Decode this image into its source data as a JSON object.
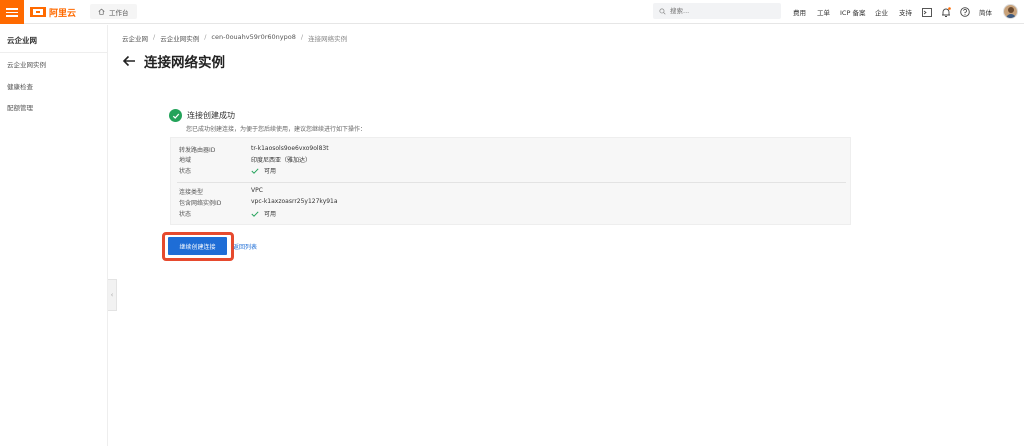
{
  "topbar": {
    "logo_text": "阿里云",
    "workbench_label": "工作台",
    "search_placeholder": "搜索...",
    "nav": [
      "费用",
      "工单",
      "ICP 备案",
      "企业",
      "支持"
    ],
    "lang_label": "简体",
    "icons": [
      "menu-icon",
      "home-icon",
      "search-icon",
      "terminal-icon",
      "bell-icon",
      "help-icon"
    ]
  },
  "sidebar": {
    "title": "云企业网",
    "items": [
      "云企业网实例",
      "健康检查",
      "配额管理"
    ]
  },
  "breadcrumb": [
    "云企业网",
    "云企业网实例",
    "cen-0ouahv59r0r60nypo8",
    "连接网络实例"
  ],
  "page": {
    "title": "连接网络实例"
  },
  "result": {
    "title": "连接创建成功",
    "description": "您已成功创建连接，为便于您后续使用，建议您继续进行如下操作："
  },
  "router_info": {
    "router_id_label": "转发路由器ID",
    "router_id_value": "tr-k1aosols9oe6vxo9ol83t",
    "region_label": "地域",
    "region_value": "印度尼西亚（雅加达）",
    "status_label": "状态",
    "status_value": "可用"
  },
  "connection_info": {
    "type_label": "连接类型",
    "type_value": "VPC",
    "instance_label": "包含网络实例ID",
    "instance_value": "vpc-k1axzoasrr25y127ky91a",
    "status_label": "状态",
    "status_value": "可用"
  },
  "actions": {
    "primary_label": "继续创建连接",
    "secondary_label": "返回列表"
  },
  "colors": {
    "brand": "#ff6a00",
    "primary": "#1e6dd6",
    "success": "#23a35a",
    "highlight": "#e64a2e"
  }
}
